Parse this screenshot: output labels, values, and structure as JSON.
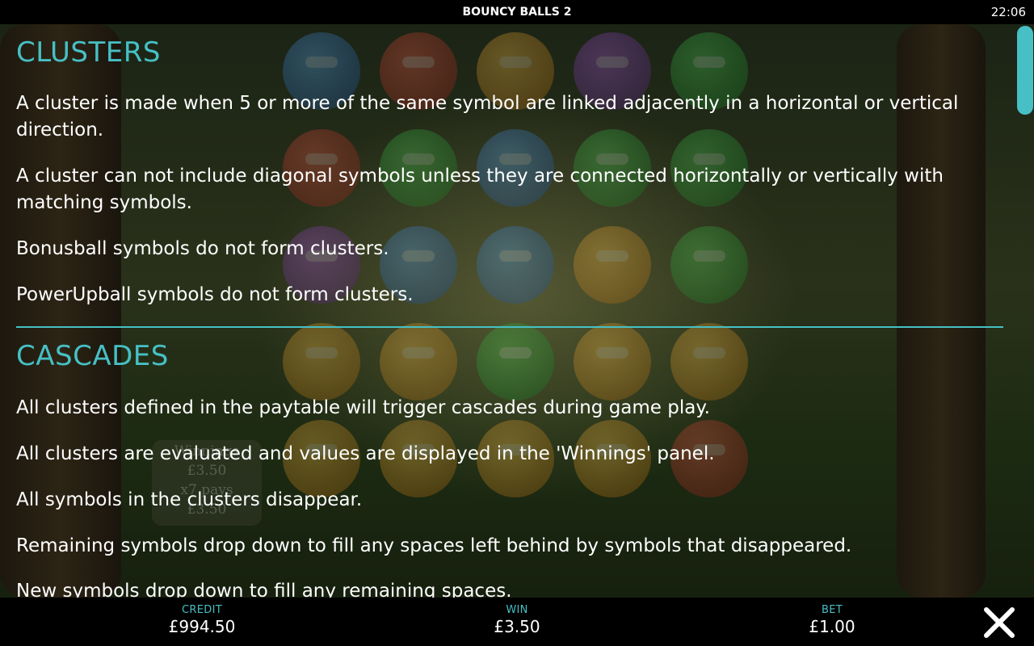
{
  "topbar": {
    "title": "BOUNCY BALLS 2",
    "clock": "22:06"
  },
  "background_panel": {
    "label": "Winnings",
    "amount": "£3.50",
    "pays": "x7 pays",
    "amount2": "£3.50"
  },
  "help": {
    "clusters": {
      "title": "CLUSTERS",
      "paragraphs": [
        "A cluster is made when 5 or more of the same symbol are linked adjacently in a horizontal or vertical direction.",
        "A cluster can not include diagonal symbols unless they are connected horizontally or vertically with matching symbols.",
        "Bonusball symbols do not form clusters.",
        "PowerUpball symbols do not form clusters."
      ]
    },
    "cascades": {
      "title": "CASCADES",
      "paragraphs": [
        "All clusters defined in the paytable will trigger cascades during game play.",
        "All clusters are evaluated and values are displayed in the 'Winnings' panel.",
        "All symbols in the clusters disappear.",
        "Remaining symbols drop down to fill any spaces left behind by symbols that disappeared.",
        "New symbols drop down to fill any remaining spaces."
      ]
    }
  },
  "bottombar": {
    "credit_label": "CREDIT",
    "credit_value": "£994.50",
    "win_label": "WIN",
    "win_value": "£3.50",
    "bet_label": "BET",
    "bet_value": "£1.00"
  },
  "colors": {
    "accent": "#46c0c5",
    "bar_background": "#000000",
    "text": "#ffffff"
  },
  "icons": {
    "close": "close-icon"
  }
}
